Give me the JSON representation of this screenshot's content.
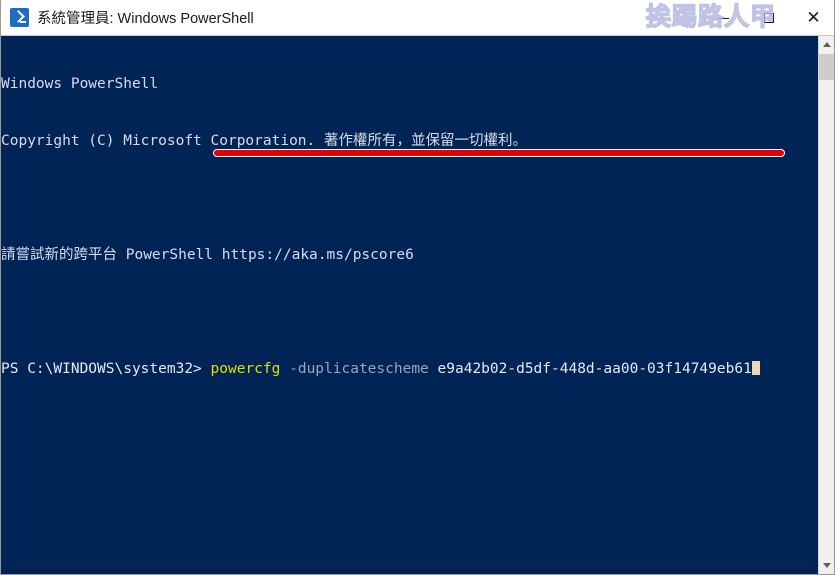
{
  "window": {
    "title": "系統管理員: Windows PowerShell",
    "icon": "powershell-icon",
    "background_color": "#012456",
    "titlebar_color": "#ffffff"
  },
  "watermark": {
    "text": "挨踢路人甲",
    "color": "#b3b6e0"
  },
  "controls": {
    "minimize_label": "",
    "maximize_label": "",
    "close_label": "✕"
  },
  "console": {
    "lines": [
      {
        "id": "l1",
        "text": "Windows PowerShell"
      },
      {
        "id": "l2",
        "text": "Copyright (C) Microsoft Corporation. 著作權所有，並保留一切權利。"
      },
      {
        "id": "l3",
        "text": ""
      },
      {
        "id": "l4",
        "text": "請嘗試新的跨平台 PowerShell https://aka.ms/pscore6"
      },
      {
        "id": "l5",
        "text": ""
      }
    ],
    "prompt": {
      "path": "PS C:\\WINDOWS\\system32>",
      "command": "powercfg",
      "flag": "-duplicatescheme",
      "argument": "e9a42b02-d5df-448d-aa00-03f14749eb61",
      "command_color": "#dfe000",
      "flag_color": "#9aa3b8",
      "argument_color": "#e6e8ee"
    }
  },
  "annotation": {
    "underline_color": "#e00000",
    "underline_border_color": "#ffffff"
  },
  "scrollbar": {
    "up_arrow": "scroll-up-icon",
    "down_arrow": "scroll-down-icon"
  }
}
